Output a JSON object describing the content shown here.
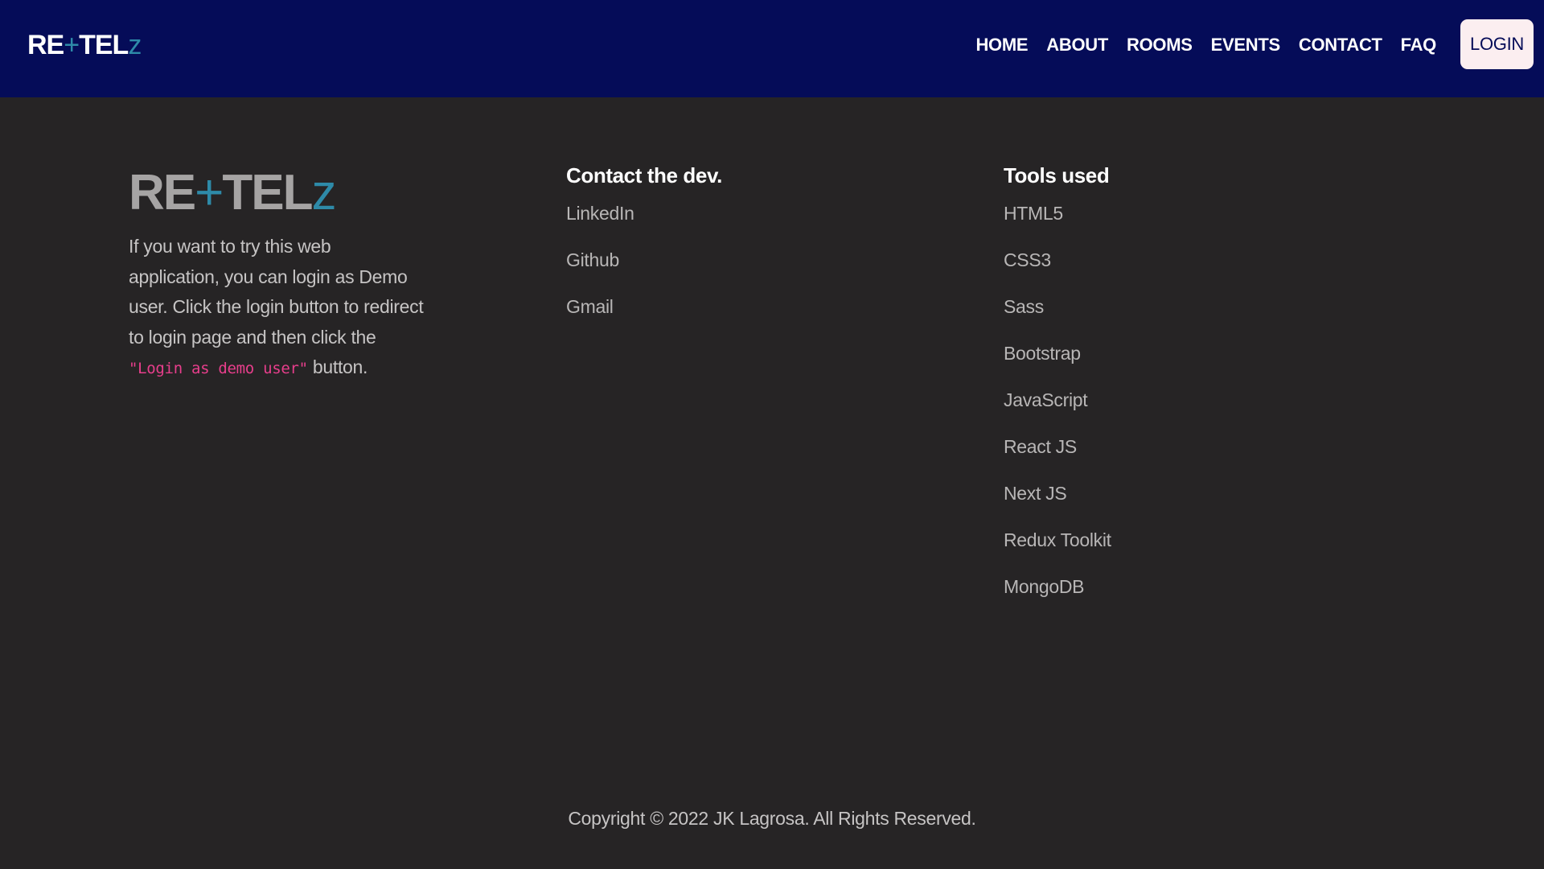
{
  "navbar": {
    "brand": {
      "part1": "RE",
      "plus": "+",
      "part2": "TEL",
      "z": "z"
    },
    "links": [
      "HOME",
      "ABOUT",
      "ROOMS",
      "EVENTS",
      "CONTACT",
      "FAQ"
    ],
    "login_label": "LOGIN"
  },
  "footer": {
    "brand": {
      "part1": "RE",
      "plus": "+",
      "part2": "TEL",
      "z": "z"
    },
    "about": {
      "text_before": "If you want to try this web application, you can login as Demo user. Click the login button to redirect to login page and then click the ",
      "code": "\"Login as demo user\"",
      "text_after": " button."
    },
    "contact": {
      "heading": "Contact the dev.",
      "links": [
        "LinkedIn",
        "Github",
        "Gmail"
      ]
    },
    "tools": {
      "heading": "Tools used",
      "items": [
        "HTML5",
        "CSS3",
        "Sass",
        "Bootstrap",
        "JavaScript",
        "React JS",
        "Next JS",
        "Redux Toolkit",
        "MongoDB"
      ]
    },
    "copyright": "Copyright © 2022 JK Lagrosa. All Rights Reserved."
  },
  "colors": {
    "navbar_bg": "#050c58",
    "page_bg": "#262425",
    "accent": "#2e8aa8",
    "code_pink": "#e83e8c",
    "login_bg": "#fbeef0"
  }
}
